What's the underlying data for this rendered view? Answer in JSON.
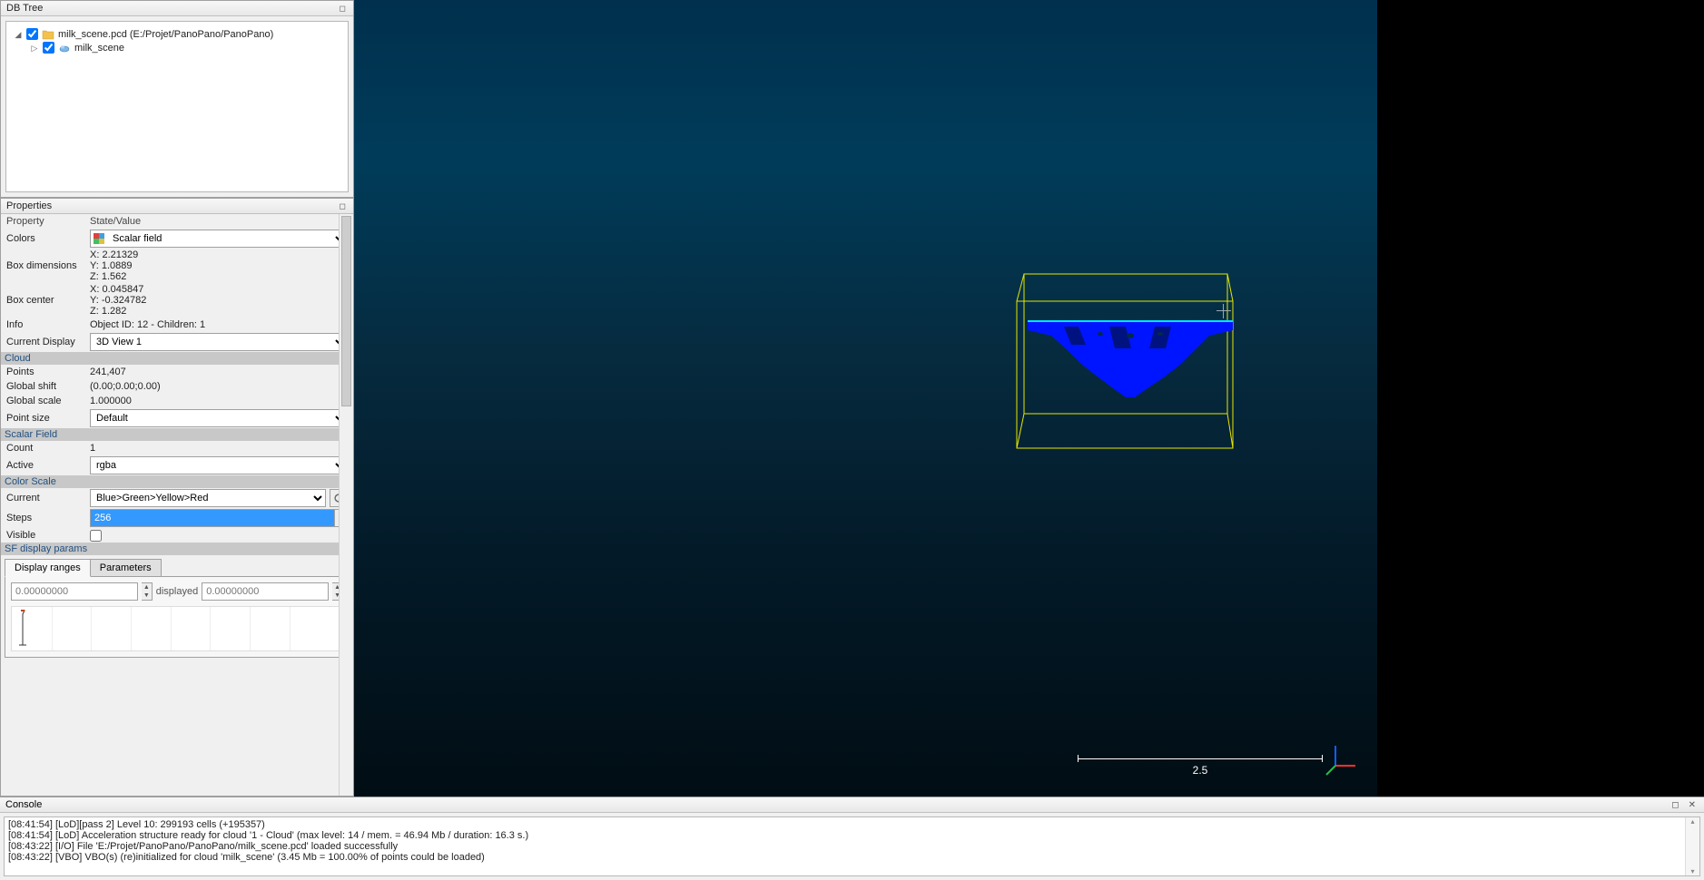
{
  "dbtree": {
    "title": "DB Tree",
    "items": [
      {
        "label": "milk_scene.pcd (E:/Projet/PanoPano/PanoPano)"
      },
      {
        "label": "milk_scene"
      }
    ]
  },
  "properties": {
    "title": "Properties",
    "header_property": "Property",
    "header_value": "State/Value",
    "colors_label": "Colors",
    "colors_value": "Scalar field",
    "box_dimensions_label": "Box dimensions",
    "box_dimensions_x": "X: 2.21329",
    "box_dimensions_y": "Y: 1.0889",
    "box_dimensions_z": "Z: 1.562",
    "box_center_label": "Box center",
    "box_center_x": "X: 0.045847",
    "box_center_y": "Y: -0.324782",
    "box_center_z": "Z: 1.282",
    "info_label": "Info",
    "info_value": "Object ID: 12 - Children: 1",
    "current_display_label": "Current Display",
    "current_display_value": "3D View 1",
    "section_cloud": "Cloud",
    "points_label": "Points",
    "points_value": "241,407",
    "global_shift_label": "Global shift",
    "global_shift_value": "(0.00;0.00;0.00)",
    "global_scale_label": "Global scale",
    "global_scale_value": "1.000000",
    "point_size_label": "Point size",
    "point_size_value": "Default",
    "section_scalar_field": "Scalar Field",
    "count_label": "Count",
    "count_value": "1",
    "active_label": "Active",
    "active_value": "rgba",
    "section_color_scale": "Color Scale",
    "current_label": "Current",
    "current_value": "Blue>Green>Yellow>Red",
    "steps_label": "Steps",
    "steps_value": "256",
    "visible_label": "Visible",
    "section_sf_display": "SF display params",
    "tab_display_ranges": "Display ranges",
    "tab_parameters": "Parameters",
    "range_min": "0.00000000",
    "range_displayed_label": "displayed",
    "range_max": "0.00000000"
  },
  "view3d": {
    "scale_value": "2.5"
  },
  "console": {
    "title": "Console",
    "lines": [
      "[08:41:54] [LoD][pass 2] Level 10: 299193 cells (+195357)",
      "[08:41:54] [LoD] Acceleration structure ready for cloud '1 - Cloud' (max level: 14 / mem. = 46.94 Mb / duration: 16.3 s.)",
      "[08:43:22] [I/O] File 'E:/Projet/PanoPano/PanoPano/milk_scene.pcd' loaded successfully",
      "[08:43:22] [VBO] VBO(s) (re)initialized for cloud 'milk_scene' (3.45 Mb = 100.00% of points could be loaded)"
    ]
  }
}
